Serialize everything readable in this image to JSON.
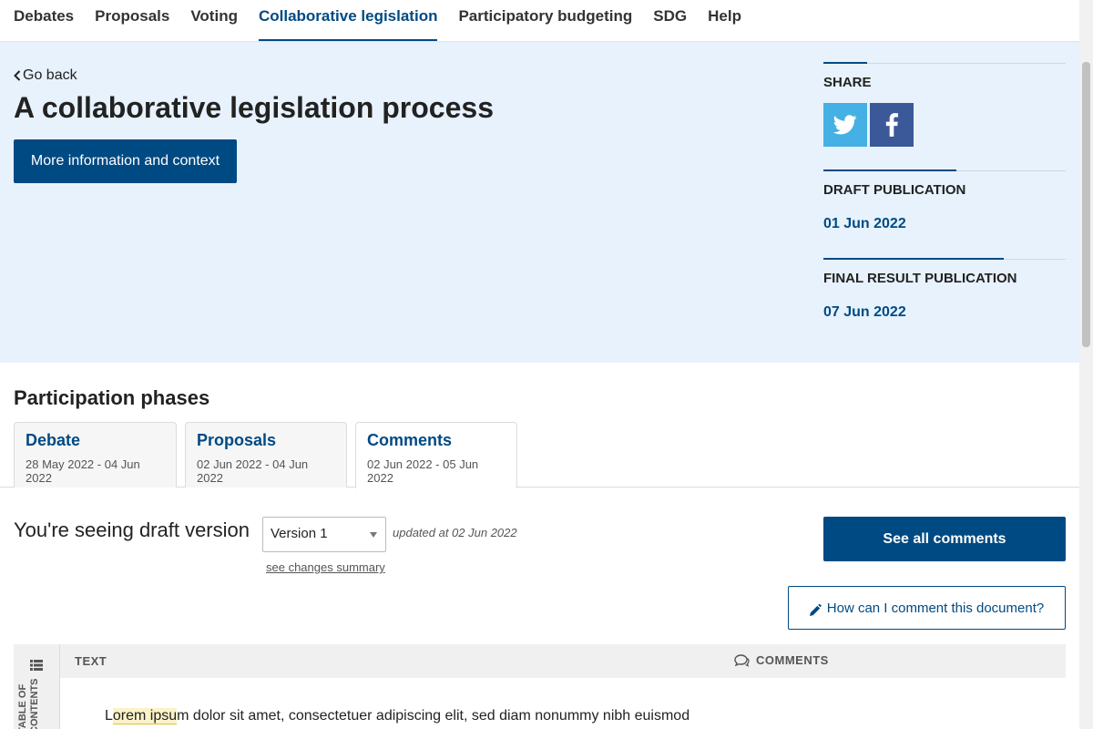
{
  "nav": {
    "items": [
      {
        "label": "Debates"
      },
      {
        "label": "Proposals"
      },
      {
        "label": "Voting"
      },
      {
        "label": "Collaborative legislation"
      },
      {
        "label": "Participatory budgeting"
      },
      {
        "label": "SDG"
      },
      {
        "label": "Help"
      }
    ],
    "active": "Collaborative legislation"
  },
  "hero": {
    "back_label": "Go back",
    "title": "A collaborative legislation process",
    "more_info_label": "More information and context"
  },
  "sidebar": {
    "share_heading": "SHARE",
    "draft_heading": "DRAFT PUBLICATION",
    "draft_date": "01 Jun 2022",
    "final_heading": "FINAL RESULT PUBLICATION",
    "final_date": "07 Jun 2022"
  },
  "phases": {
    "title": "Participation phases",
    "items": [
      {
        "name": "Debate",
        "dates": "28 May 2022 - 04 Jun 2022"
      },
      {
        "name": "Proposals",
        "dates": "02 Jun 2022 - 04 Jun 2022"
      },
      {
        "name": "Comments",
        "dates": "02 Jun 2022 - 05 Jun 2022"
      }
    ],
    "active": "Comments"
  },
  "draft": {
    "label": "You're seeing draft version",
    "selected_version": "Version 1",
    "updated": "updated at 02 Jun 2022",
    "changes_link": "see changes summary",
    "see_all_label": "See all comments",
    "how_comment_label": "How can I comment this document?"
  },
  "document": {
    "toc_label": "Table of contents",
    "text_heading": "TEXT",
    "comments_heading": "COMMENTS",
    "first_line_prefix": "L",
    "first_line_highlight": "orem ipsu",
    "first_line_rest": "m dolor sit amet, consectetuer adipiscing elit, sed diam nonummy nibh euismod"
  },
  "colors": {
    "primary": "#004a83",
    "hero_bg": "#e7f2fc",
    "twitter": "#45b0e3",
    "facebook": "#3b5998"
  },
  "icons": {
    "back": "chevron-left-icon",
    "twitter": "twitter-icon",
    "facebook": "facebook-icon",
    "pencil": "pencil-icon",
    "toc": "list-icon",
    "comments": "speech-bubbles-icon"
  }
}
